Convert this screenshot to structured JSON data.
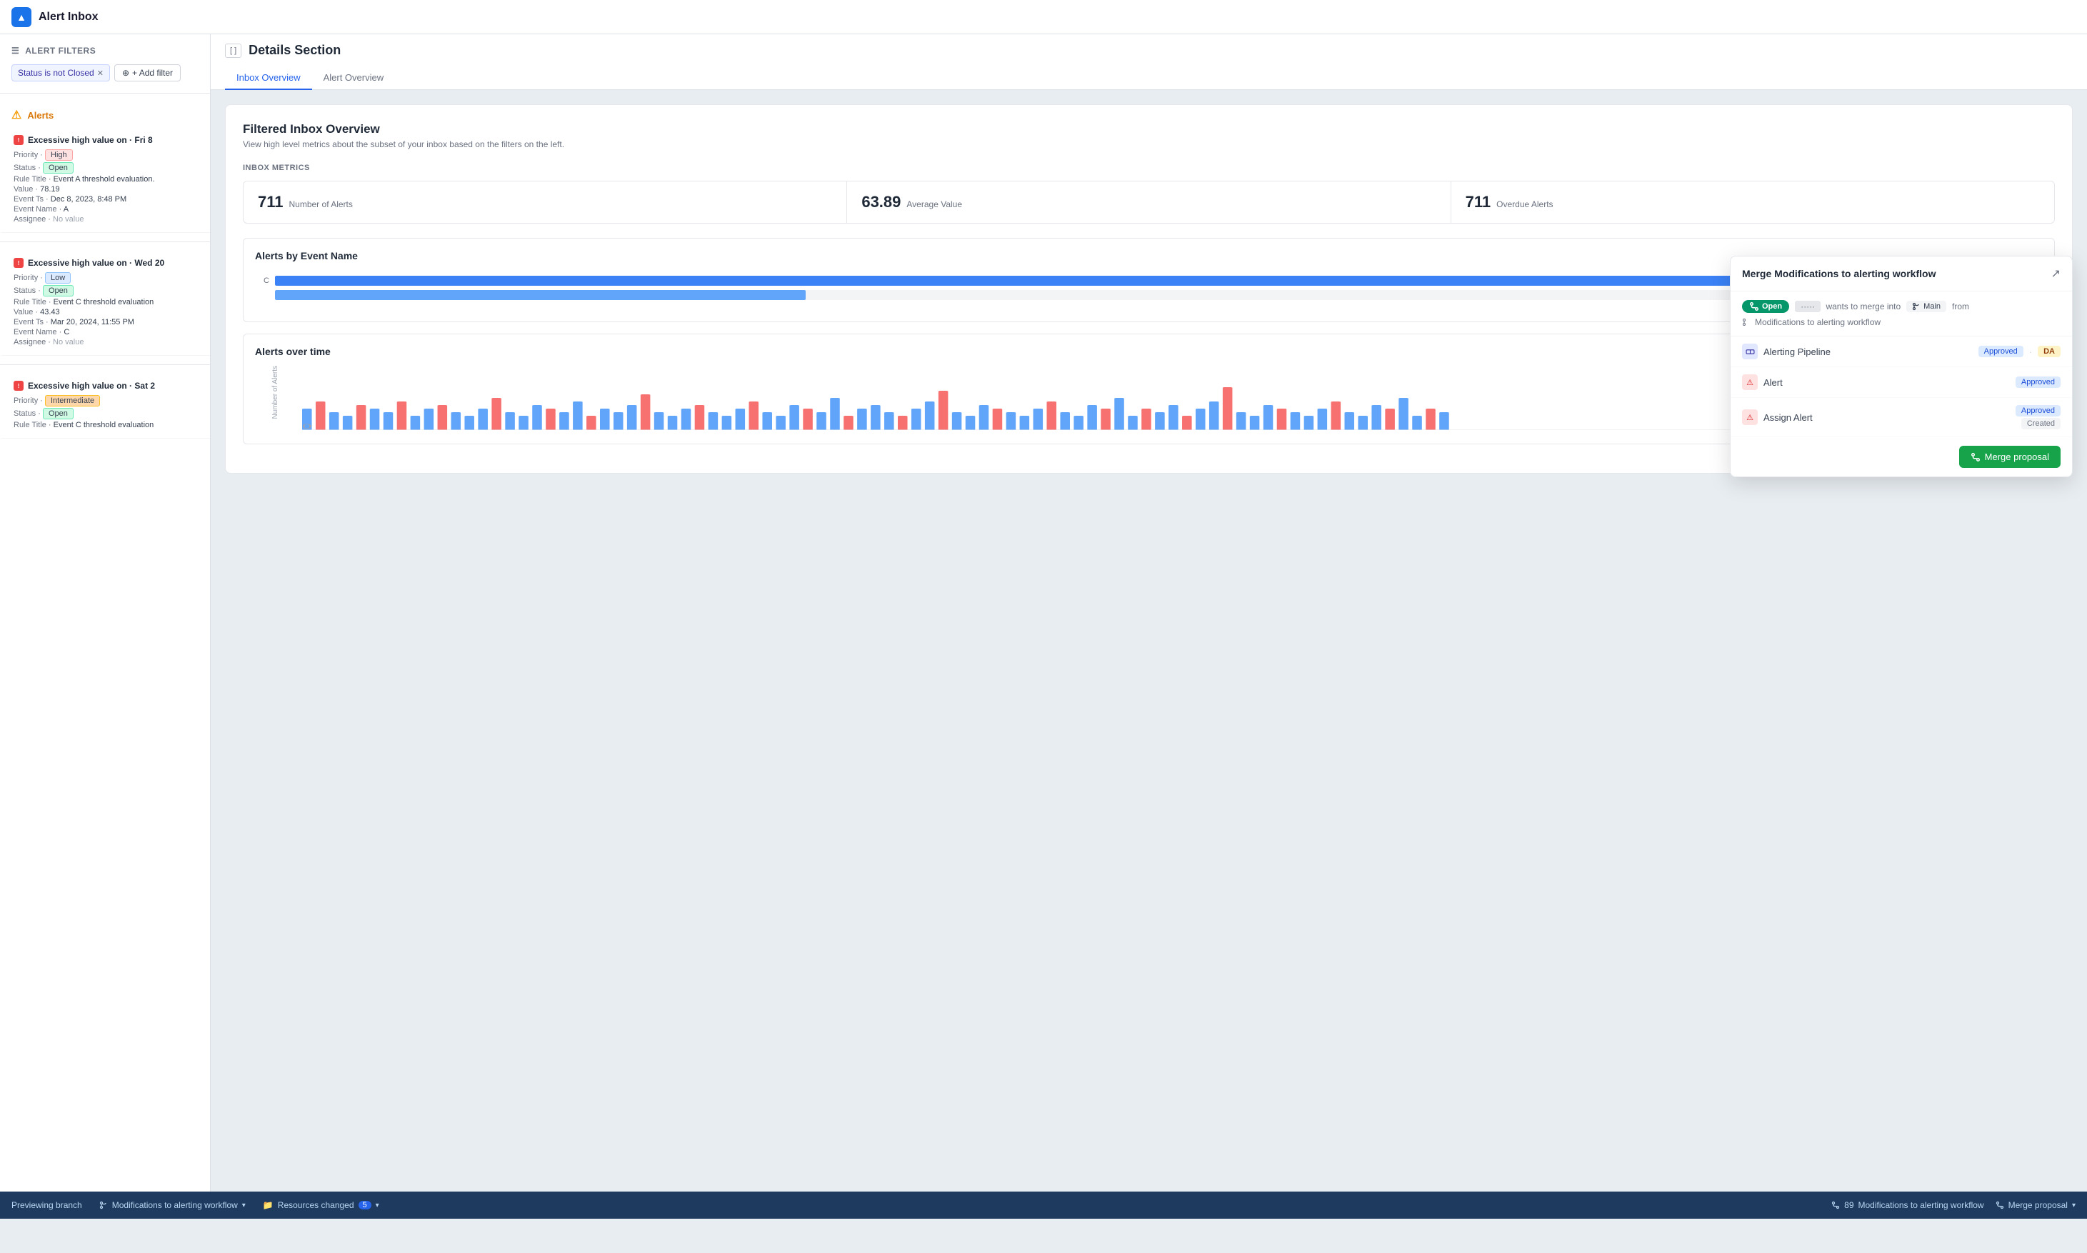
{
  "header": {
    "logo_text": "▲",
    "title": "Alert Inbox"
  },
  "sidebar": {
    "filters_label": "Alert Filters",
    "active_filter": "Status is not Closed",
    "add_filter_label": "+ Add filter",
    "alerts_label": "Alerts",
    "alerts": [
      {
        "id": 1,
        "title": "Excessive high value on · Fri 8",
        "priority": "High",
        "status": "Open",
        "rule_title": "Event A threshold evaluation.",
        "value": "78.19",
        "event_ts": "Dec 8, 2023, 8:48 PM",
        "event_name": "A",
        "assignee": "No value"
      },
      {
        "id": 2,
        "title": "Excessive high value on · Wed 20",
        "priority": "Low",
        "status": "Open",
        "rule_title": "Event C threshold evaluation",
        "value": "43.43",
        "event_ts": "Mar 20, 2024, 11:55 PM",
        "event_name": "C",
        "assignee": "No value"
      },
      {
        "id": 3,
        "title": "Excessive high value on · Sat 2",
        "priority": "Intermediate",
        "status": "Open",
        "rule_title": "Event C threshold evaluation",
        "value": "",
        "event_ts": "",
        "event_name": "",
        "assignee": ""
      }
    ]
  },
  "details": {
    "section_title": "Details Section",
    "collapse_label": "[ ]",
    "tabs": [
      {
        "id": "inbox",
        "label": "Inbox Overview",
        "active": true
      },
      {
        "id": "alert",
        "label": "Alert Overview",
        "active": false
      }
    ]
  },
  "overview": {
    "title": "Filtered Inbox Overview",
    "subtitle": "View high level metrics about the subset of your inbox based on the filters on the left.",
    "metrics_label": "INBOX METRICS",
    "metrics": [
      {
        "value": "711",
        "label": "Number of Alerts"
      },
      {
        "value": "63.89",
        "label": "Average Value"
      },
      {
        "value": "711",
        "label": "Overdue Alerts"
      }
    ],
    "chart1_title": "Alerts by Event Name",
    "chart2_title": "Alerts over time",
    "chart2_y_label": "Number of Alerts",
    "hbars": [
      {
        "label": "C",
        "pct": 95
      },
      {
        "label": "",
        "pct": 30
      }
    ]
  },
  "merge_popup": {
    "title": "Merge Modifications to alerting workflow",
    "badge_open": "Open",
    "merge_into_text": "wants to merge into",
    "main_branch": "Main",
    "from_text": "from",
    "branch_name": "Modifications to alerting workflow",
    "rows": [
      {
        "icon_type": "pipeline",
        "label": "Alerting Pipeline",
        "approved": "Approved",
        "extra": "DA"
      },
      {
        "icon_type": "alert",
        "label": "Alert",
        "approved": "Approved",
        "extra": ""
      },
      {
        "icon_type": "assign",
        "label": "Assign Alert",
        "approved": "Approved",
        "created": "Created",
        "extra": ""
      }
    ],
    "merge_btn_label": "Merge proposal"
  },
  "status_bar": {
    "previewing_label": "Previewing branch",
    "branch_name": "Modifications to alerting workflow",
    "branch_arrow": "▾",
    "resources_label": "Resources changed",
    "resources_count": "5",
    "resources_arrow": "▾",
    "merge_count": "89",
    "merge_label": "Modifications to alerting workflow",
    "merge_proposal_label": "Merge proposal",
    "merge_proposal_arrow": "▾"
  }
}
